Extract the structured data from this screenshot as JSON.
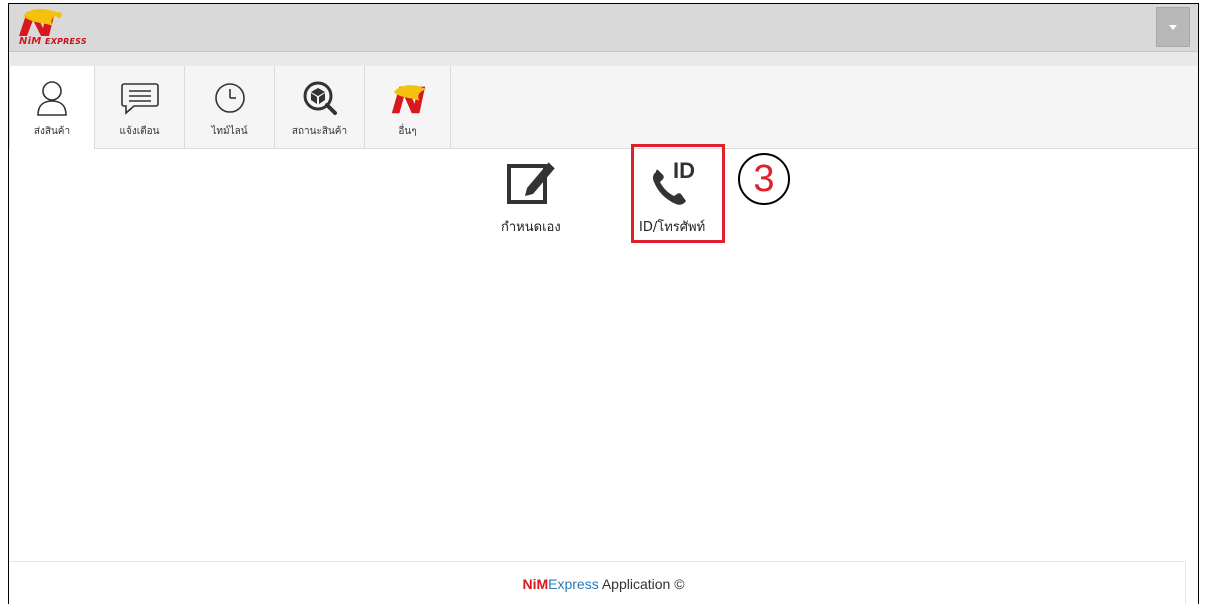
{
  "header": {
    "logo_text_main": "NiM",
    "logo_text_sub": "EXPRESS",
    "menu_icon": "caret-down-icon"
  },
  "tabs": [
    {
      "label": "ส่งสินค้า",
      "icon": "user-icon"
    },
    {
      "label": "แจ้งเตือน",
      "icon": "message-icon"
    },
    {
      "label": "ไทม์ไลน์",
      "icon": "clock-icon"
    },
    {
      "label": "สถานะสินค้า",
      "icon": "package-search-icon"
    },
    {
      "label": "อื่นๆ",
      "icon": "nim-logo-icon"
    }
  ],
  "actions": [
    {
      "label": "กำหนดเอง",
      "icon": "edit-icon"
    },
    {
      "label": "ID/โทรศัพท์",
      "icon": "phone-id-icon"
    }
  ],
  "annotation": {
    "step": "3",
    "color": "#e0212d"
  },
  "footer": {
    "brand_nim": "NiM",
    "brand_express": "Express",
    "text": " Application ©"
  }
}
